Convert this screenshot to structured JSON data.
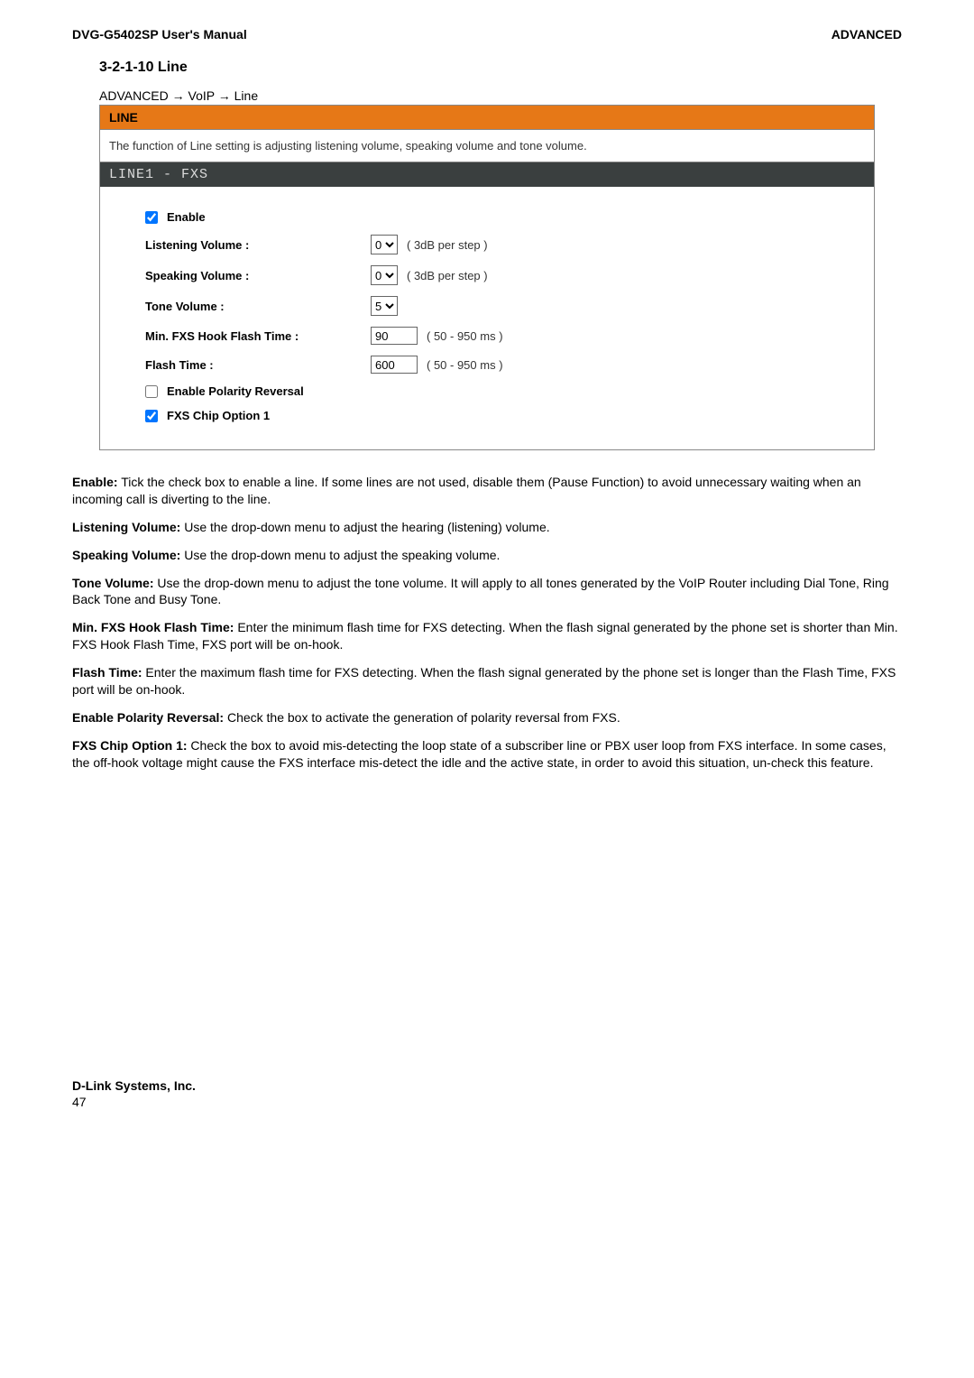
{
  "header": {
    "left": "DVG-G5402SP User's Manual",
    "right": "ADVANCED"
  },
  "section": {
    "title": "3-2-1-10 Line",
    "breadcrumb": "ADVANCED  →  VoIP  →  Line"
  },
  "panel": {
    "title": "LINE",
    "desc": "The function of Line setting is adjusting listening volume, speaking volume and tone volume.",
    "subheader": "LINE1 - FXS"
  },
  "form": {
    "enable_label": "Enable",
    "listening_label": "Listening Volume :",
    "listening_value": "0",
    "listening_help": "( 3dB per step )",
    "speaking_label": "Speaking Volume :",
    "speaking_value": "0",
    "speaking_help": "( 3dB per step )",
    "tone_label": "Tone Volume :",
    "tone_value": "5",
    "minfxs_label": "Min. FXS Hook Flash Time :",
    "minfxs_value": "90",
    "minfxs_help": "( 50 - 950 ms )",
    "flash_label": "Flash Time :",
    "flash_value": "600",
    "flash_help": "( 50 - 950 ms )",
    "polarity_label": "Enable Polarity Reversal",
    "fxschip_label": "FXS Chip Option 1"
  },
  "paras": {
    "p1_term": "Enable:",
    "p1_text": " Tick the check box to enable a line. If some lines are not used, disable them (Pause Function) to avoid unnecessary waiting when an incoming call is diverting to the line.",
    "p2_term": "Listening Volume:",
    "p2_text": " Use the drop-down menu to adjust the hearing (listening) volume.",
    "p3_term": "Speaking Volume:",
    "p3_text": " Use the drop-down menu to adjust the speaking volume.",
    "p4_term": "Tone Volume:",
    "p4_text": " Use the drop-down menu to adjust the tone volume. It will apply to all tones generated by the VoIP Router including Dial Tone, Ring Back Tone and Busy Tone.",
    "p5_term": "Min. FXS Hook Flash Time:",
    "p5_text": " Enter the minimum flash time for FXS detecting. When the flash signal generated by the phone set is shorter than Min. FXS Hook Flash Time, FXS port will be on-hook.",
    "p6_term": "Flash Time:",
    "p6_text": "   Enter the maximum flash time for FXS detecting. When the flash signal generated by the phone set is longer than the Flash Time, FXS port will be on-hook.",
    "p7_term": "Enable Polarity Reversal:",
    "p7_text": " Check the box to activate the generation of polarity reversal from FXS.",
    "p8_term": "FXS Chip Option 1:",
    "p8_text": " Check the box to avoid mis-detecting the loop state of a subscriber line or PBX user loop from FXS interface. In some cases, the off-hook voltage might cause the FXS interface mis-detect the idle and the active state, in order to avoid this situation, un-check this feature."
  },
  "footer": {
    "company": "D-Link Systems, Inc.",
    "page": "47"
  }
}
